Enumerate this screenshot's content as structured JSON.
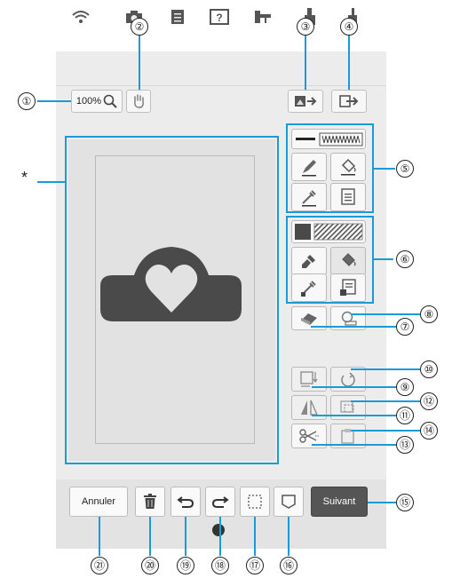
{
  "zoom": {
    "value": "100%"
  },
  "asterisk": "*",
  "buttons": {
    "annuler": "Annuler",
    "suivant": "Suivant"
  },
  "callouts": [
    "①",
    "②",
    "③",
    "④",
    "⑤",
    "⑥",
    "⑦",
    "⑧",
    "⑨",
    "⑩",
    "⑪",
    "⑫",
    "⑬",
    "⑭",
    "⑮",
    "⑯",
    "⑰",
    "⑱",
    "⑲",
    "⑳",
    "㉑"
  ],
  "status_icons": [
    "wifi-icon",
    "camera-icon",
    "document-icon",
    "help-icon",
    "thread-icon",
    "presser-foot-icon",
    "needle-icon"
  ],
  "colors": {
    "accent": "#1a9ad6",
    "shape": "#4a4a4a",
    "suivant": "#555555",
    "screen": "#ececec"
  }
}
